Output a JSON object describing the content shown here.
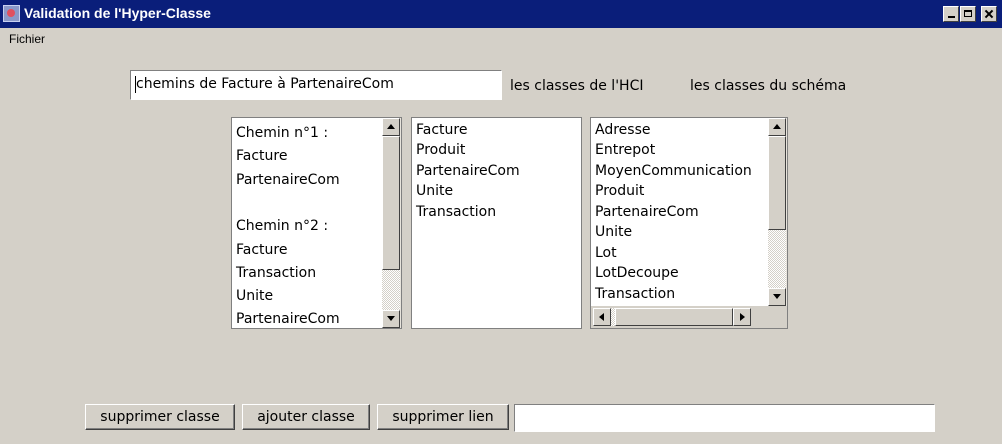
{
  "window": {
    "title": "Validation de l'Hyper-Classe"
  },
  "menu": {
    "items": [
      "Fichier"
    ]
  },
  "header": {
    "path_field_value": "chemins de Facture à PartenaireCom",
    "label_hci_classes": "les classes de l'HCI",
    "label_schema_classes": "les classes du schéma"
  },
  "paths_list": {
    "items": [
      "Chemin n°1 :",
      "Facture",
      "PartenaireCom",
      "",
      "Chemin n°2 :",
      "Facture",
      "Transaction",
      "Unite",
      "PartenaireCom"
    ]
  },
  "hci_list": {
    "items": [
      "Facture",
      "Produit",
      "PartenaireCom",
      "Unite",
      "Transaction"
    ]
  },
  "schema_list": {
    "items": [
      "Adresse",
      "Entrepot",
      "MoyenCommunication",
      "Produit",
      "PartenaireCom",
      "Unite",
      "Lot",
      "LotDecoupe",
      "Transaction"
    ]
  },
  "buttons": {
    "remove_class": "supprimer classe",
    "add_class": "ajouter classe",
    "remove_link": "supprimer lien"
  },
  "footer": {
    "input_value": ""
  },
  "icons": {
    "app": "app-icon",
    "minimize": "minimize-icon",
    "maximize": "maximize-icon",
    "close": "close-icon",
    "scroll_up": "arrow-up-icon",
    "scroll_down": "arrow-down-icon",
    "scroll_left": "arrow-left-icon",
    "scroll_right": "arrow-right-icon"
  },
  "colors": {
    "titlebar": "#0a1e7a",
    "window_bg": "#d4d0c8",
    "field_bg": "#ffffff"
  }
}
